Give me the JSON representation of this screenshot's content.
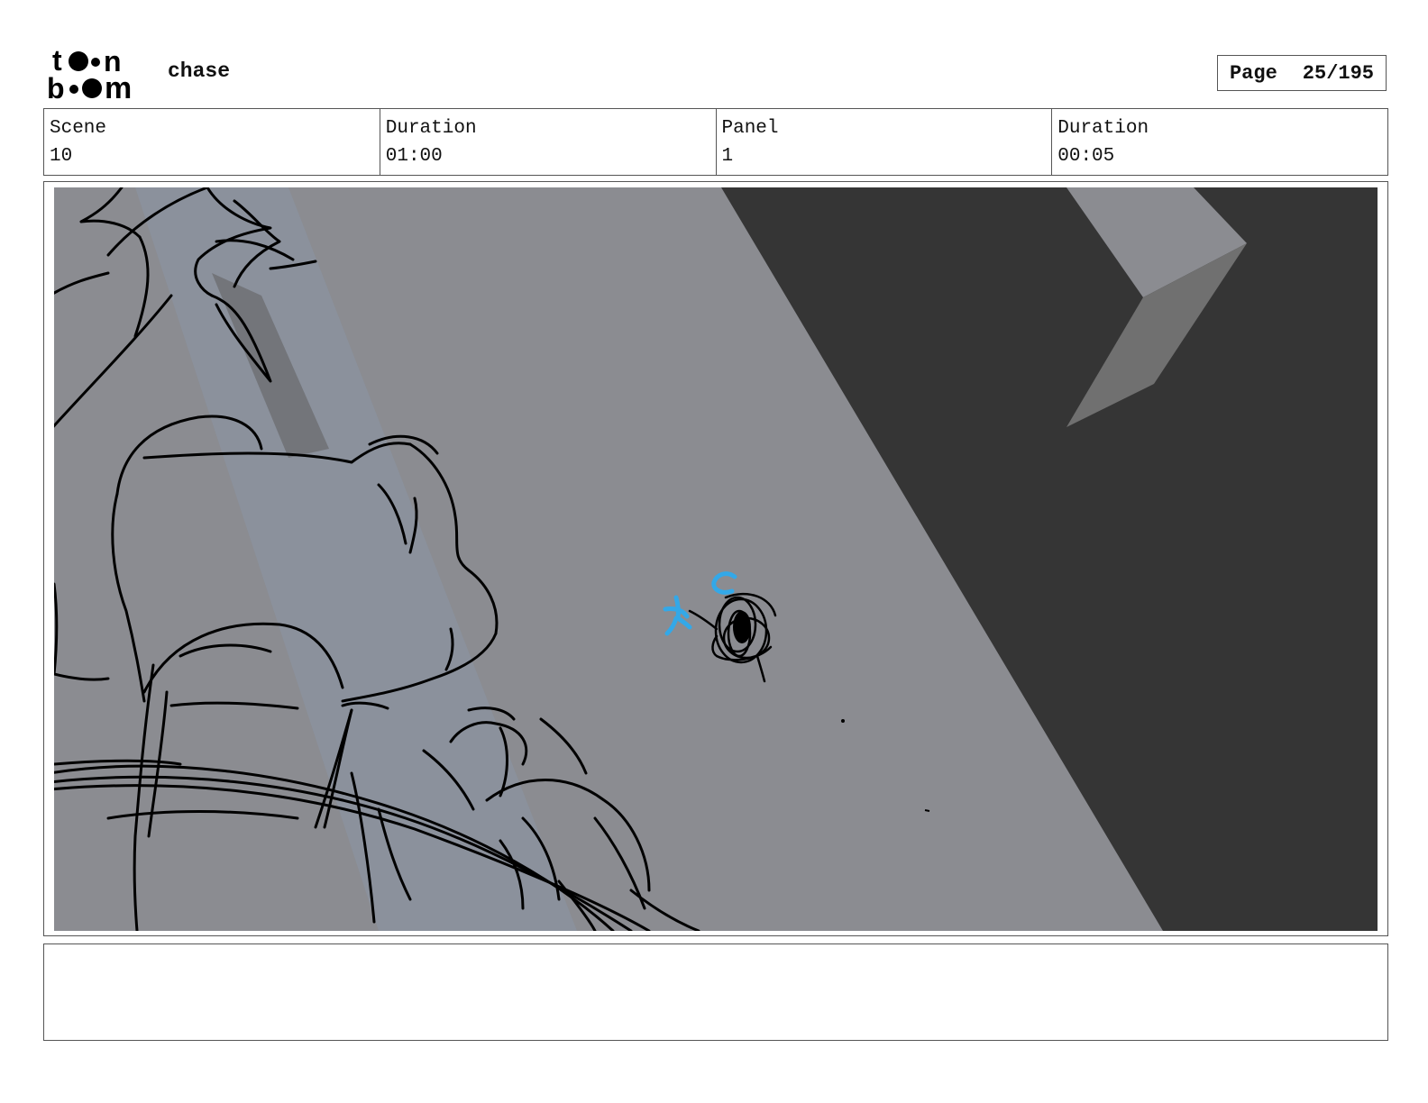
{
  "header": {
    "logo_text": "toon boom",
    "project_title": "chase",
    "page_label": "Page",
    "page_number": "25/195"
  },
  "info": {
    "scene_label": "Scene",
    "scene_value": "10",
    "scene_duration_label": "Duration",
    "scene_duration_value": "01:00",
    "panel_label": "Panel",
    "panel_value": "1",
    "panel_duration_label": "Duration",
    "panel_duration_value": "00:05"
  },
  "colors": {
    "floor_gray": "#8b8c91",
    "dark_area": "#353535",
    "sketch_line": "#000000",
    "blue_sketch": "#33a8e8"
  },
  "notes": {
    "text": ""
  }
}
